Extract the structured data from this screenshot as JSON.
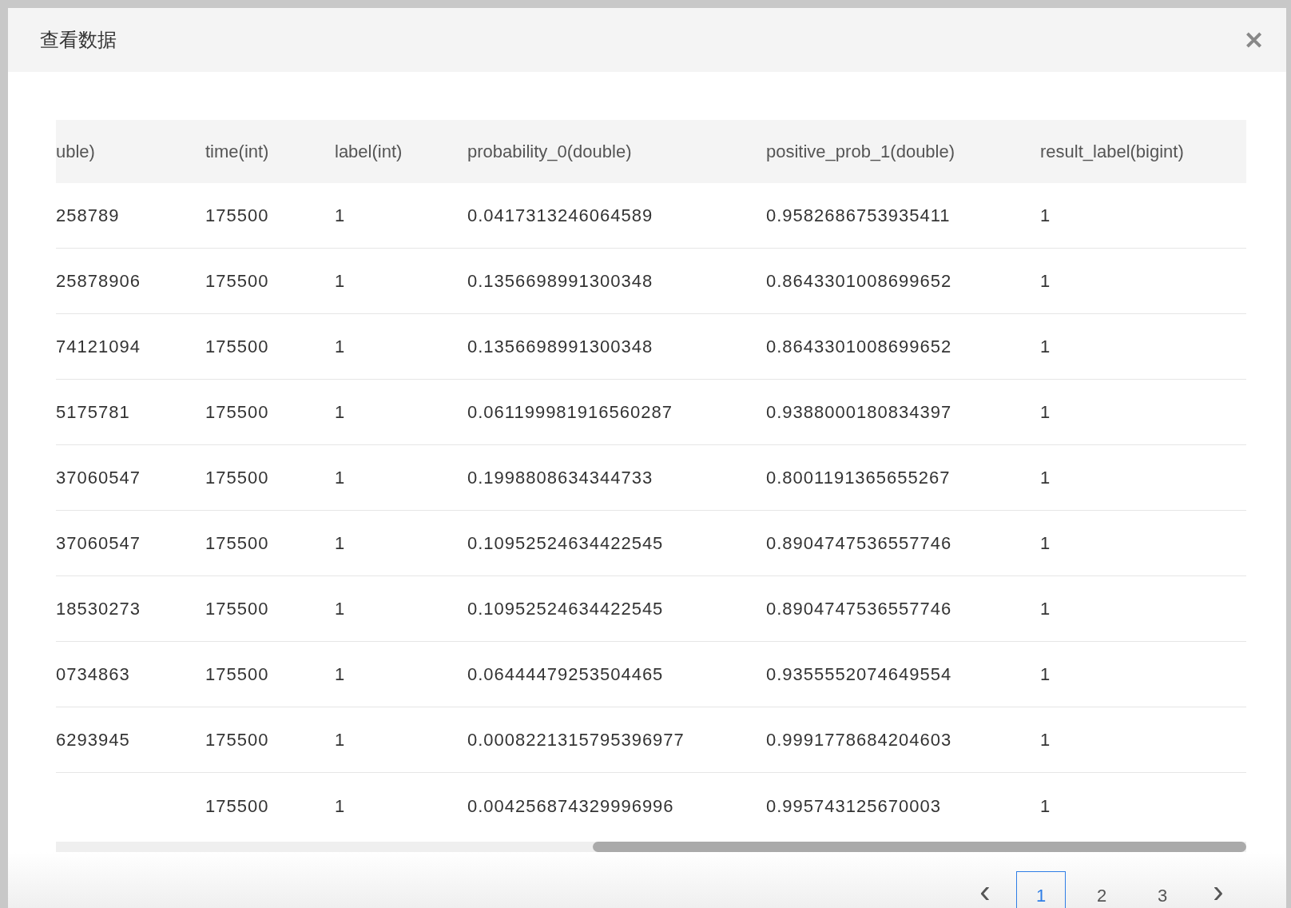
{
  "dialog": {
    "title": "查看数据",
    "close": "✕"
  },
  "table": {
    "columns": [
      "uble)",
      "time(int)",
      "label(int)",
      "probability_0(double)",
      "positive_prob_1(double)",
      "result_label(bigint)"
    ],
    "rows": [
      [
        "258789",
        "175500",
        "1",
        "0.0417313246064589",
        "0.9582686753935411",
        "1"
      ],
      [
        "25878906",
        "175500",
        "1",
        "0.1356698991300348",
        "0.8643301008699652",
        "1"
      ],
      [
        "74121094",
        "175500",
        "1",
        "0.1356698991300348",
        "0.8643301008699652",
        "1"
      ],
      [
        "5175781",
        "175500",
        "1",
        "0.061199981916560287",
        "0.9388000180834397",
        "1"
      ],
      [
        "37060547",
        "175500",
        "1",
        "0.1998808634344733",
        "0.8001191365655267",
        "1"
      ],
      [
        "37060547",
        "175500",
        "1",
        "0.10952524634422545",
        "0.8904747536557746",
        "1"
      ],
      [
        "18530273",
        "175500",
        "1",
        "0.10952524634422545",
        "0.8904747536557746",
        "1"
      ],
      [
        "0734863",
        "175500",
        "1",
        "0.06444479253504465",
        "0.9355552074649554",
        "1"
      ],
      [
        "6293945",
        "175500",
        "1",
        "0.0008221315795396977",
        "0.9991778684204603",
        "1"
      ],
      [
        "",
        "175500",
        "1",
        "0.004256874329996996",
        "0.995743125670003",
        "1"
      ]
    ]
  },
  "pagination": {
    "prev": "‹",
    "next": "›",
    "pages": [
      {
        "label": "1",
        "selected": true
      },
      {
        "label": "2",
        "selected": false
      },
      {
        "label": "3",
        "selected": false
      }
    ]
  }
}
